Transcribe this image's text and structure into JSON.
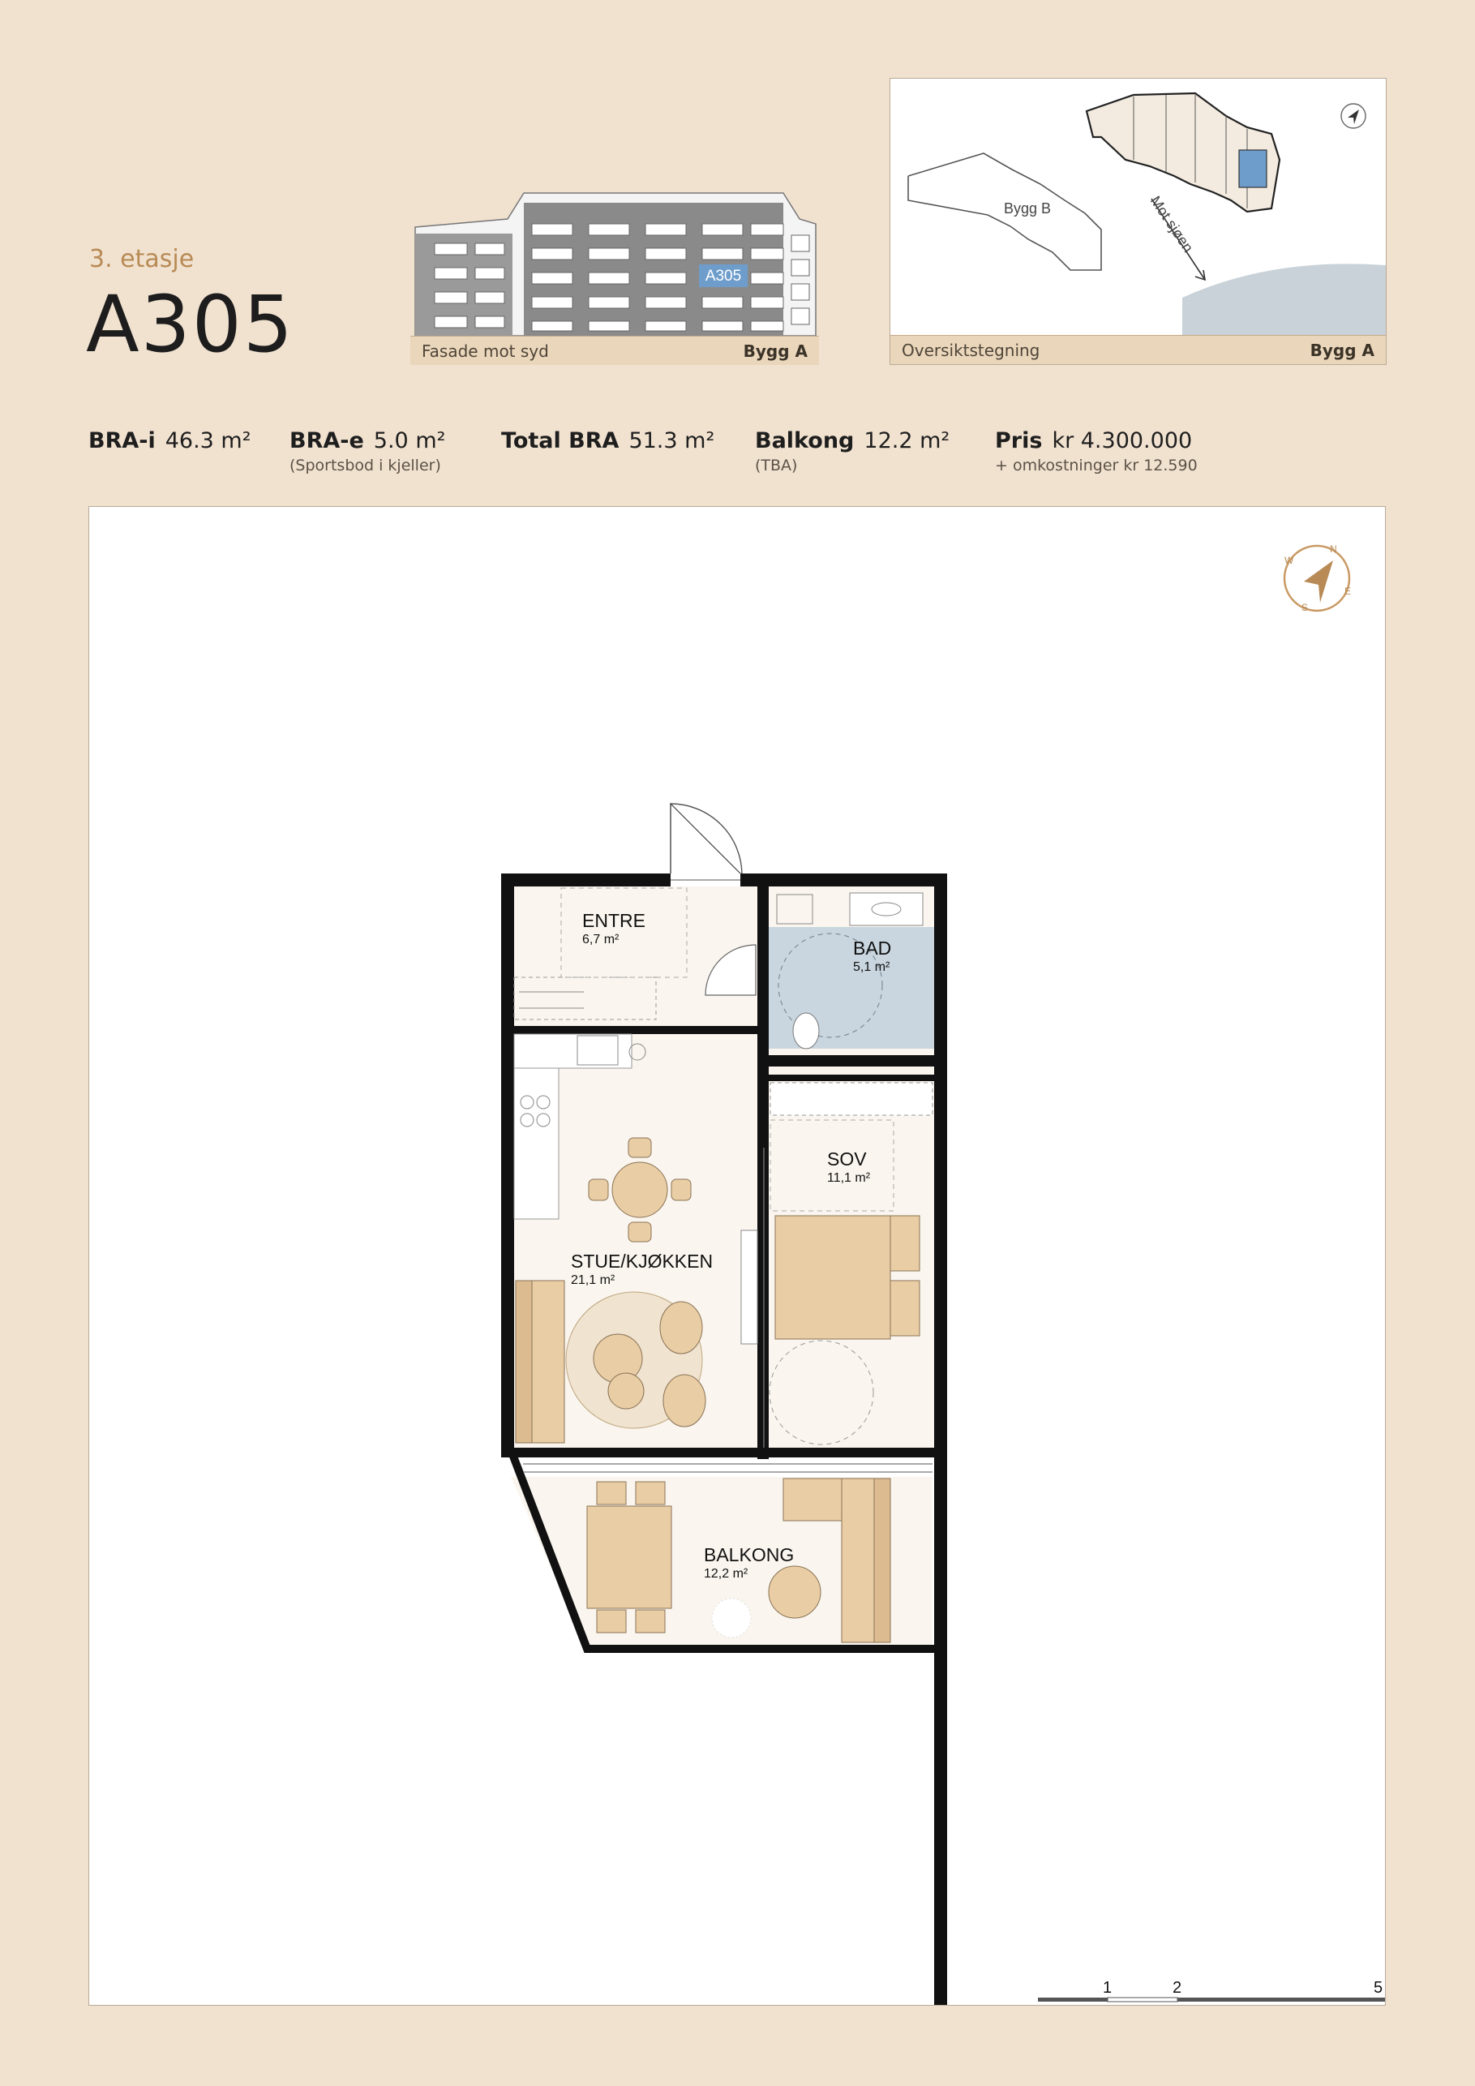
{
  "header": {
    "floor": "3. etasje",
    "unit": "A305"
  },
  "facade": {
    "caption_left": "Fasade mot syd",
    "caption_right": "Bygg A",
    "highlight_label": "A305"
  },
  "site_map": {
    "caption_left": "Oversiktstegning",
    "caption_right": "Bygg A",
    "building_b_label": "Bygg B",
    "direction_label": "Mot sjøen"
  },
  "stats": {
    "bra_i": {
      "label": "BRA-i",
      "value": "46.3 m²"
    },
    "bra_e": {
      "label": "BRA-e",
      "value": "5.0 m²",
      "note": "(Sportsbod i kjeller)"
    },
    "total_bra": {
      "label": "Total BRA",
      "value": "51.3 m²"
    },
    "balkong": {
      "label": "Balkong",
      "value": "12.2 m²",
      "note": "(TBA)"
    },
    "pris": {
      "label": "Pris",
      "value": "kr 4.300.000",
      "note": "+ omkostninger kr 12.590"
    }
  },
  "floorplan": {
    "rooms": [
      {
        "name": "ENTRE",
        "area": "6,7 m²"
      },
      {
        "name": "BAD",
        "area": "5,1 m²"
      },
      {
        "name": "SOV",
        "area": "11,1 m²"
      },
      {
        "name": "STUE/KJØKKEN",
        "area": "21,1 m²"
      },
      {
        "name": "BALKONG",
        "area": "12,2 m²"
      }
    ],
    "compass_letters": [
      "N",
      "E",
      "S",
      "W"
    ]
  },
  "scale_bar": {
    "labels": [
      "1",
      "2",
      "5"
    ]
  },
  "colors": {
    "background": "#f1e2d0",
    "accent": "#b88a55",
    "highlight": "#6e9dcc",
    "bathroom": "#c9d6df",
    "furniture": "#e9cda5",
    "wall": "#111111"
  }
}
